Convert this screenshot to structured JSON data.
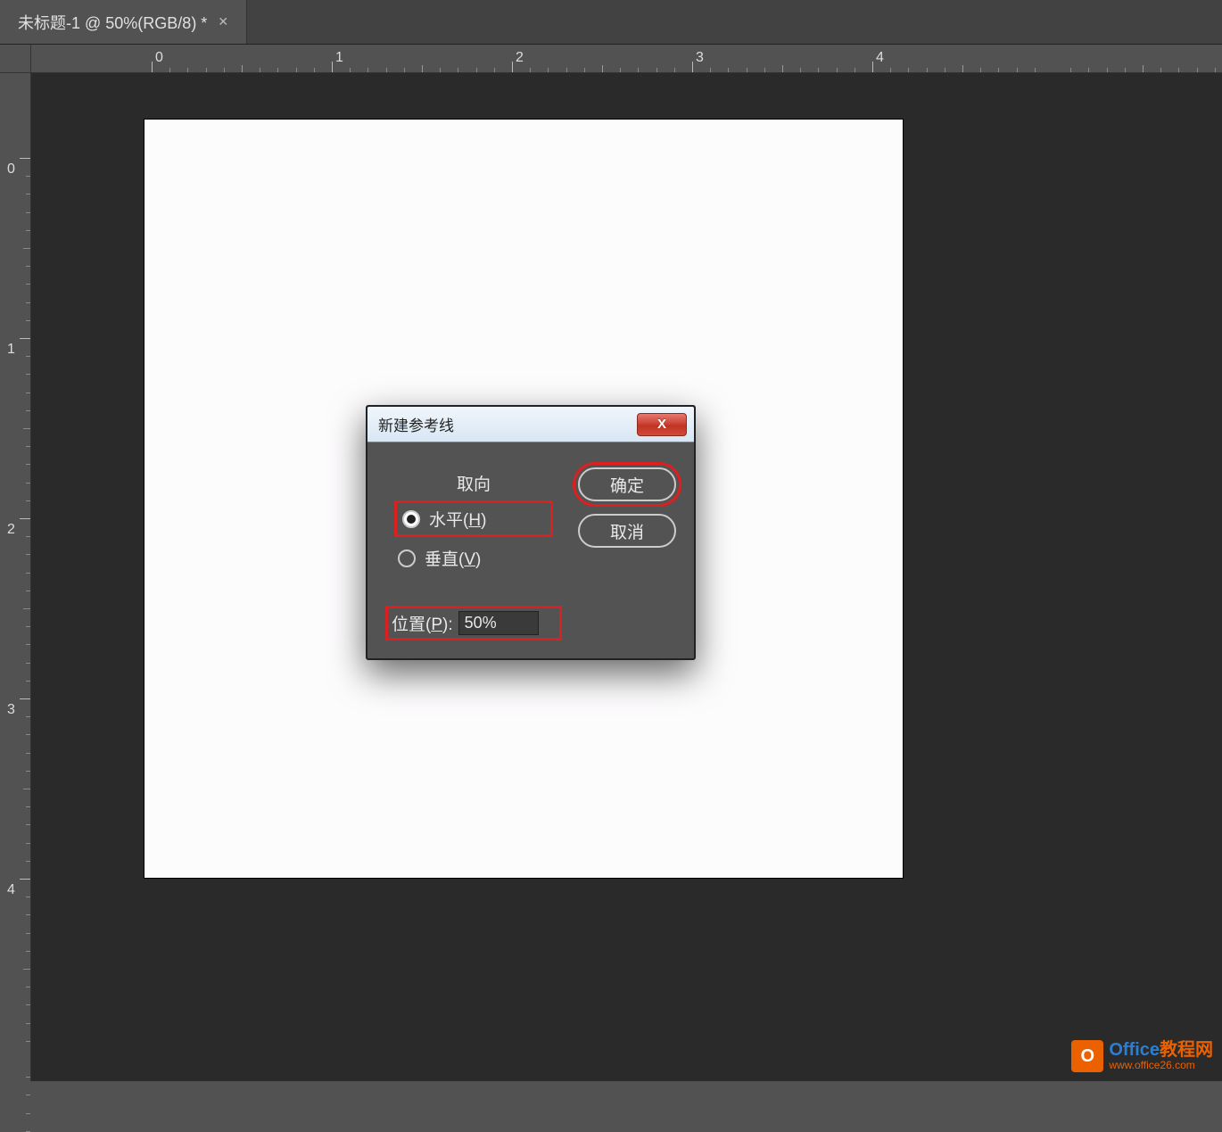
{
  "tab": {
    "title": "未标题-1 @ 50%(RGB/8) *",
    "close": "✕"
  },
  "ruler": {
    "h_labels": [
      "0",
      "1",
      "2",
      "3",
      "4"
    ],
    "v_labels": [
      "0",
      "1",
      "2",
      "3",
      "4"
    ]
  },
  "dialog": {
    "title": "新建参考线",
    "close_symbol": "X",
    "orientation": {
      "legend": "取向",
      "horizontal": "水平(H)",
      "vertical": "垂直(V)",
      "selected": "horizontal"
    },
    "position": {
      "label": "位置(P):",
      "value": "50%"
    },
    "buttons": {
      "ok": "确定",
      "cancel": "取消"
    }
  },
  "watermark": {
    "icon_letter": "O",
    "title_part1": "Office",
    "title_part2": "教程网",
    "url": "www.office26.com"
  }
}
